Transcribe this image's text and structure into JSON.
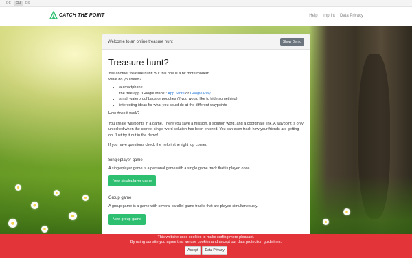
{
  "languages": [
    {
      "code": "DE",
      "active": false
    },
    {
      "code": "EN",
      "active": true
    },
    {
      "code": "ES",
      "active": false
    }
  ],
  "brand": {
    "name": "CATCH THE POINT",
    "logo_icon": "tent-icon"
  },
  "nav": {
    "links": [
      "Help",
      "Imprint",
      "Data Privacy"
    ]
  },
  "card": {
    "header_title": "Welcome to an online treasure hunt",
    "demo_button": "Show Demo",
    "title": "Treasure hunt?",
    "intro_line1": "Yes another treasure hunt! But this one is a bit more modern.",
    "intro_line2": "What do you need?",
    "needs": {
      "item1": "a smartphone",
      "item2_prefix": "the free app \"Google Maps\": ",
      "item2_link1": "App Store",
      "item2_or": " or ",
      "item2_link2": "Google Play",
      "item3": "small waterproof bags or pouches (if you would like to hide something)",
      "item4": "interesting ideas for what you could do at the different waypoints"
    },
    "how_title": "How does it work?",
    "how_text": "You create waypoints in a game. There you save a mission, a solution word, and a coordinate link. A waypoint is only unlocked when the correct single word solution has been entered. You can even track how your friends are getting on. Just try it out in the demo!",
    "help_text": "If you have questions check the help in the right top corner.",
    "single": {
      "title": "Singleplayer game",
      "text": "A singleplayer game is a personal game with a single game track that is played once.",
      "button": "New singleplayer game"
    },
    "group": {
      "title": "Group game",
      "text": "A group game is a game with several parallel game tracks that are played simultaneously.",
      "button": "New group game"
    }
  },
  "cookie": {
    "line1": "This website uses cookies to make surfing more pleasant.",
    "line2": "By using our site you agree that we use cookies and accept our data protection guidelines.",
    "accept": "Accept",
    "privacy": "Data Privacy"
  },
  "colors": {
    "accent_green": "#2fbf71",
    "cookie_red": "#e3343a",
    "link_blue": "#2b7bd8",
    "demo_gray": "#6c757d"
  }
}
